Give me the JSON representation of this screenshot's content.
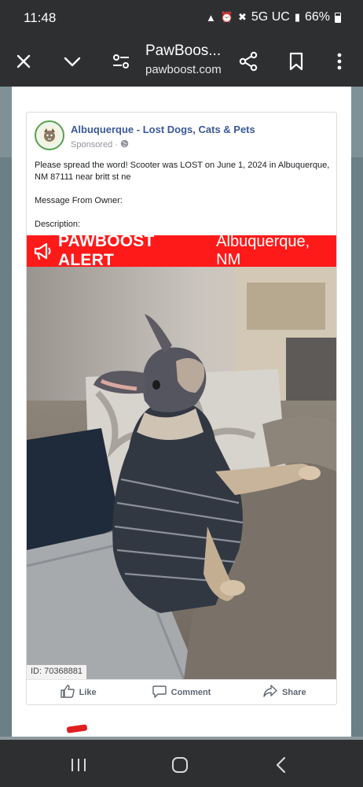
{
  "status_bar": {
    "time": "11:48",
    "network": "5G UC",
    "battery": "66%"
  },
  "toolbar": {
    "title": "PawBoos...",
    "domain": "pawboost.com",
    "icons": [
      "close-icon",
      "chevron-down-icon",
      "page-settings-icon",
      "share-icon",
      "bookmark-icon",
      "more-icon"
    ]
  },
  "post": {
    "group_name": "Albuquerque - Lost Dogs, Cats & Pets",
    "sponsored": "Sponsored",
    "lines": {
      "text1": "Please spread the word! Scooter was LOST on June 1, 2024 in Albuquerque, NM 87111 near britt st ne",
      "text2": "Message From Owner:",
      "text3": "Description:"
    },
    "alert": {
      "brand": "PAWBOOST ALERT",
      "location": "Albuquerque, NM"
    },
    "photo_id": "ID: 70368881",
    "actions": {
      "like": "Like",
      "comment": "Comment",
      "share": "Share"
    }
  },
  "colors": {
    "alert_red": "#ff1a1a",
    "link_blue": "#3b5998",
    "chrome_dark": "#2e2f31"
  }
}
